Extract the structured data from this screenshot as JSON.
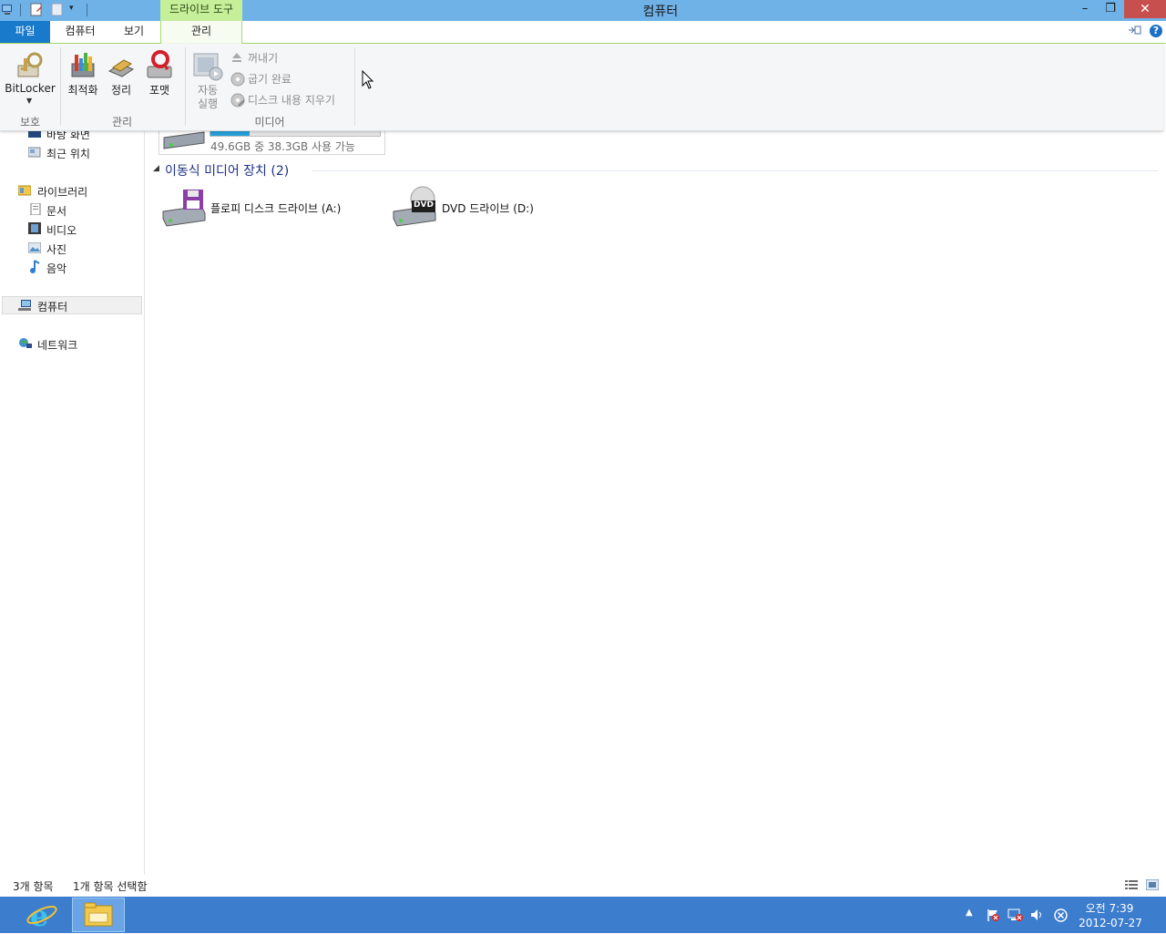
{
  "window": {
    "title": "컴퓨터",
    "context_tab": "드라이브 도구",
    "controls": {
      "minimize": "–",
      "maximize": "❐",
      "close": "✕"
    }
  },
  "ribbon": {
    "tabs": [
      {
        "label": "파일"
      },
      {
        "label": "컴퓨터"
      },
      {
        "label": "보기"
      },
      {
        "label": "관리"
      }
    ],
    "groups": {
      "protect": {
        "label": "보호",
        "bitlocker": "BitLocker"
      },
      "manage": {
        "label": "관리",
        "optimize": "최적화",
        "cleanup": "정리",
        "format": "포맷"
      },
      "media": {
        "label": "미디어",
        "autoplay_line1": "자동",
        "autoplay_line2": "실행",
        "eject": "꺼내기",
        "finish_burning": "굽기 완료",
        "erase_disc": "디스크 내용 지우기"
      }
    },
    "help": "?"
  },
  "nav": {
    "desktop_partial": "바탕 화면",
    "recent": "최근 위치",
    "libraries": "라이브러리",
    "documents": "문서",
    "videos": "비디오",
    "pictures": "사진",
    "music": "음악",
    "computer": "컴퓨터",
    "network": "네트워크"
  },
  "content": {
    "local_disk": {
      "free_text": "49.6GB 중 38.3GB 사용 가능",
      "used_fraction": 0.23
    },
    "removable_section": "이동식 미디어 장치 (2)",
    "drives": [
      {
        "label": "플로피 디스크 드라이브 (A:)"
      },
      {
        "label": "DVD 드라이브 (D:)",
        "badge": "DVD"
      }
    ]
  },
  "status": {
    "items_count": "3개 항목",
    "selected": "1개 항목 선택함"
  },
  "taskbar": {
    "time": "오전 7:39",
    "date": "2012-07-27"
  },
  "colors": {
    "titlebar": "#6fb2e8",
    "context_tab": "#c6ef9a",
    "file_tab": "#1979ca",
    "taskbar": "#3c7dcd",
    "section_title": "#1e3287"
  }
}
